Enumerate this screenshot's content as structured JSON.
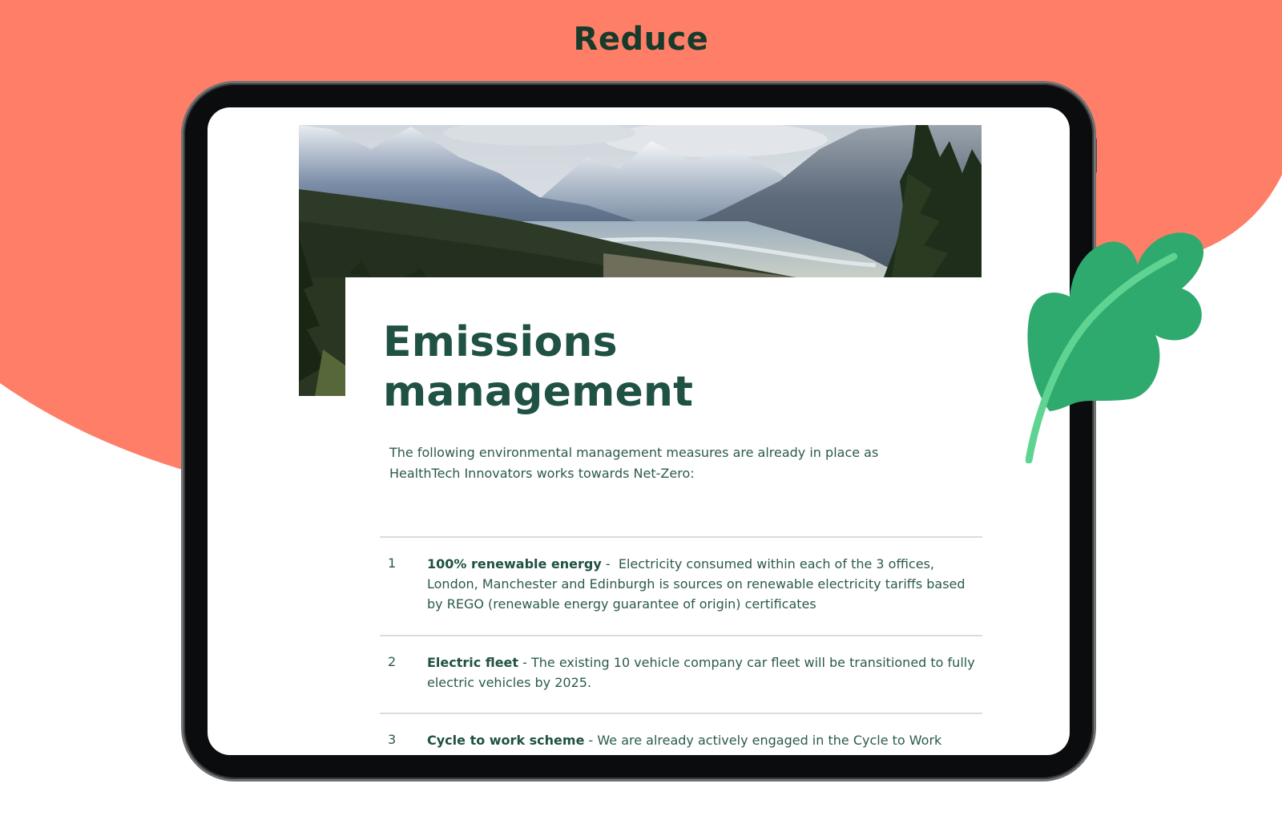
{
  "page": {
    "heading": "Reduce"
  },
  "document": {
    "title_line1": "Emissions",
    "title_line2": "management",
    "intro": "The following environmental management measures are already in place as HealthTech Innovators works towards Net-Zero:",
    "measures": [
      {
        "number": "1",
        "label": "100% renewable energy",
        "separator": " -  ",
        "text": "Electricity consumed within each of the 3 offices, London, Manchester and Edinburgh is sources on renewable electricity tariffs based by REGO (renewable energy guarantee of origin) certificates"
      },
      {
        "number": "2",
        "label": "Electric fleet",
        "separator": " - ",
        "text": "The existing 10 vehicle company car fleet will be transitioned to fully electric vehicles by 2025."
      },
      {
        "number": "3",
        "label": "Cycle to work scheme",
        "separator": " - ",
        "text": "We are already actively engaged in the Cycle to Work"
      }
    ]
  },
  "colors": {
    "background_blob": "#ff7e67",
    "heading": "#183a2b",
    "title": "#1f5144",
    "body_text": "#2b5a4d",
    "leaf": "#2eaa6e",
    "leaf_vein": "#5fd492",
    "tablet_frame": "#0b0c0d"
  },
  "icons": {
    "leaf": "leaf-icon",
    "hero": "mountain-landscape-photo"
  }
}
